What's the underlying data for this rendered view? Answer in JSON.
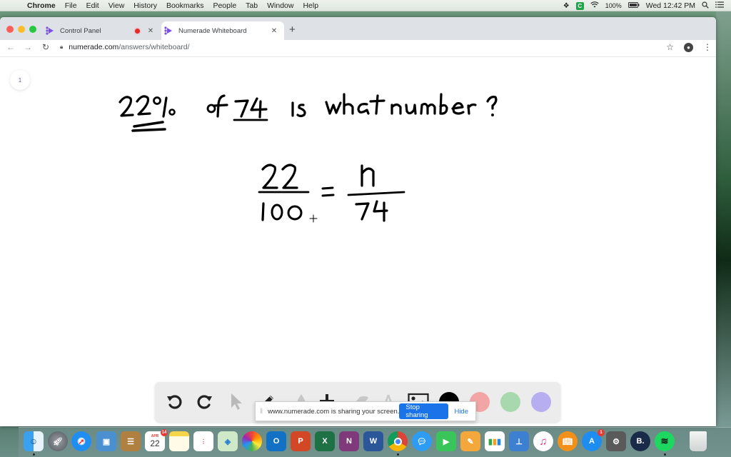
{
  "menubar": {
    "app_name": "Chrome",
    "menus": [
      "File",
      "Edit",
      "View",
      "History",
      "Bookmarks",
      "People",
      "Tab",
      "Window",
      "Help"
    ],
    "status": {
      "battery": "100%",
      "clock": "Wed 12:42 PM",
      "c_badge": "C"
    }
  },
  "browser": {
    "tabs": [
      {
        "title": "Control Panel",
        "recording": true,
        "active": false
      },
      {
        "title": "Numerade Whiteboard",
        "recording": false,
        "active": true
      }
    ],
    "url_host": "numerade.com",
    "url_path": "/answers/whiteboard/"
  },
  "whiteboard": {
    "page_number": "1",
    "handwritten": {
      "question": "22% of 74 is what number?",
      "equation": "22/100 = n/74",
      "numerator_left": "22",
      "denominator_left": "100",
      "numerator_right": "n",
      "denominator_right": "74"
    },
    "toolbar": {
      "tools": [
        "undo",
        "redo",
        "select",
        "pen",
        "highlighter",
        "add",
        "eraser",
        "text",
        "image"
      ],
      "colors": [
        "#000000",
        "#f2a5a5",
        "#a8d8ad",
        "#b7aef0"
      ],
      "selected_color": "#000000"
    }
  },
  "share_bar": {
    "message": "www.numerade.com is sharing your screen.",
    "stop_label": "Stop sharing",
    "hide_label": "Hide"
  },
  "dock": {
    "apps": [
      {
        "name": "Finder",
        "running": true
      },
      {
        "name": "Launchpad"
      },
      {
        "name": "Safari"
      },
      {
        "name": "Preview"
      },
      {
        "name": "Contacts"
      },
      {
        "name": "Calendar",
        "label": "22",
        "month": "APR",
        "badge": "14"
      },
      {
        "name": "Notes"
      },
      {
        "name": "Reminders"
      },
      {
        "name": "Maps"
      },
      {
        "name": "Photos"
      },
      {
        "name": "Outlook",
        "label": "O"
      },
      {
        "name": "PowerPoint",
        "label": "P"
      },
      {
        "name": "Excel",
        "label": "X"
      },
      {
        "name": "OneNote",
        "label": "N"
      },
      {
        "name": "Word",
        "label": "W"
      },
      {
        "name": "Chrome",
        "running": true
      },
      {
        "name": "Messages"
      },
      {
        "name": "FaceTime"
      },
      {
        "name": "Pages"
      },
      {
        "name": "Numbers"
      },
      {
        "name": "Keynote"
      },
      {
        "name": "iTunes"
      },
      {
        "name": "iBooks"
      },
      {
        "name": "App Store",
        "badge": "1"
      },
      {
        "name": "System Preferences"
      },
      {
        "name": "Backup",
        "label": "B."
      },
      {
        "name": "Spotify",
        "running": true
      },
      {
        "name": "Trash"
      }
    ]
  }
}
